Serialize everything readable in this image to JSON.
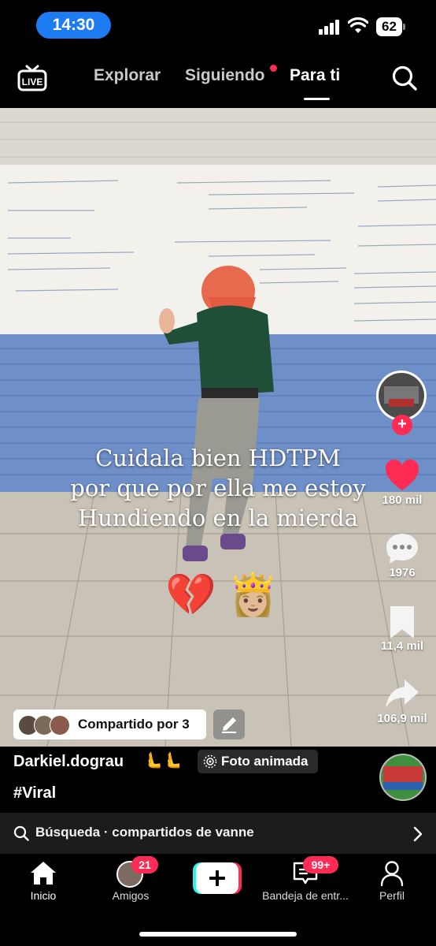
{
  "status_bar": {
    "time": "14:30",
    "battery": "62"
  },
  "top_nav": {
    "tabs": [
      {
        "label": "Explorar"
      },
      {
        "label": "Siguiendo"
      },
      {
        "label": "Para ti"
      }
    ]
  },
  "video": {
    "caption_lines": [
      "Cuidala bien HDTPM",
      "por que por ella me estoy",
      "Hundiendo en la mierda"
    ],
    "emojis": "💔 👸🏼"
  },
  "rail": {
    "likes": "180 mil",
    "comments": "1976",
    "saves": "11,4 mil",
    "shares": "106,9 mil"
  },
  "shared": {
    "label": "Compartido por 3"
  },
  "post": {
    "username": "Darkiel.dograu",
    "username_emoji": "🫷🫷",
    "chip": "Foto animada",
    "hashtag": "#Viral"
  },
  "search_strip": {
    "text": "Búsqueda · compartidos de vanne"
  },
  "bottom_nav": {
    "items": [
      {
        "label": "Inicio"
      },
      {
        "label": "Amigos",
        "badge": "21"
      },
      {
        "label": ""
      },
      {
        "label": "Bandeja de entr...",
        "badge": "99+"
      },
      {
        "label": "Perfil"
      }
    ]
  },
  "colors": {
    "accent": "#fe2c55",
    "status_pill": "#1e7cf2",
    "create_left": "#25f4ee",
    "create_right": "#fe2c55"
  }
}
